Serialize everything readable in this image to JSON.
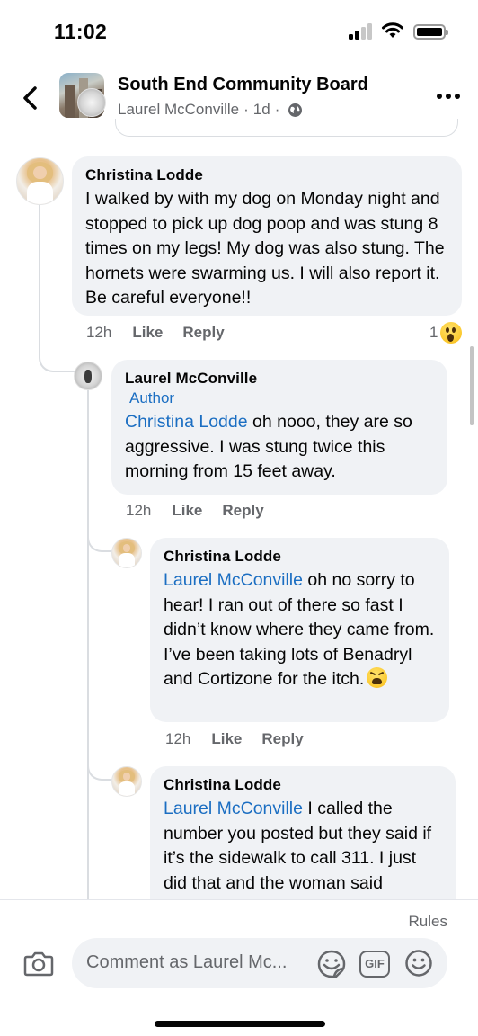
{
  "status_bar": {
    "time": "11:02"
  },
  "header": {
    "group_name": "South End Community Board",
    "poster": "Laurel McConville",
    "age": "1d",
    "separator": "·"
  },
  "comments": [
    {
      "author": "Christina Lodde",
      "text": "I walked by with my dog on Monday night and stopped to pick up dog poop and was stung 8 times on my legs! My dog was also stung. The hornets were swarming us. I will also report it. Be careful everyone!!",
      "time": "12h",
      "like_label": "Like",
      "reply_label": "Reply",
      "reaction_count": "1",
      "reaction_icon": "wow-emoji"
    },
    {
      "author": "Laurel McConville",
      "badge": "Author",
      "mention": "Christina Lodde",
      "text": " oh nooo, they are so aggressive. I was stung twice this morning from 15 feet away.",
      "time": "12h",
      "like_label": "Like",
      "reply_label": "Reply"
    },
    {
      "author": "Christina Lodde",
      "mention": "Laurel McConville",
      "text": " oh no sorry to hear! I ran out of there so fast I didn’t know where they came from. I’ve been taking lots of Benadryl and Cortizone for the itch.",
      "emoji": "tired-face-emoji",
      "time": "12h",
      "like_label": "Like",
      "reply_label": "Reply"
    },
    {
      "author": "Christina Lodde",
      "mention": "Laurel McConville",
      "text": " I called the number you posted but they said if it’s the sidewalk to call 311. I just did that and the woman said"
    }
  ],
  "composer": {
    "rules_label": "Rules",
    "placeholder": "Comment as Laurel Mc...",
    "gif_label": "GIF"
  },
  "icons": {
    "back": "chevron-left-icon",
    "more": "more-horizontal-icon",
    "privacy": "globe-icon",
    "camera": "camera-icon",
    "sticker": "sticker-icon",
    "emoji": "smiley-icon"
  }
}
